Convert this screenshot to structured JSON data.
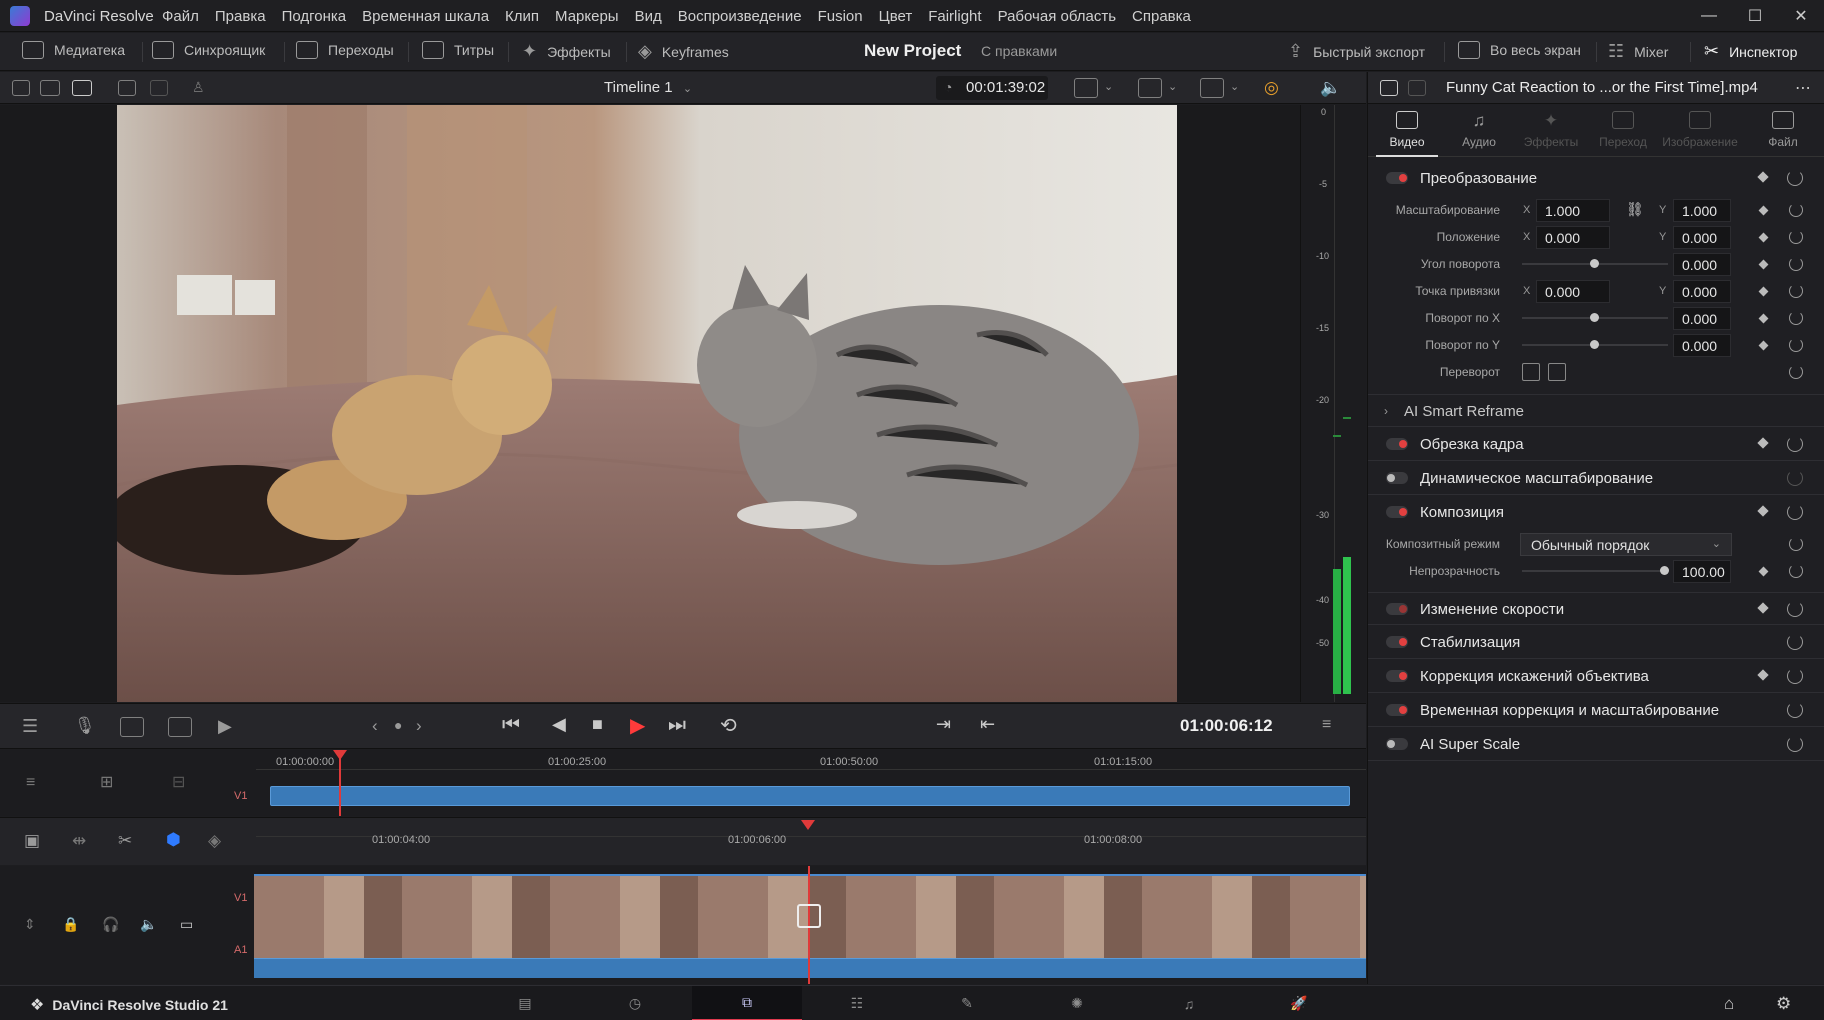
{
  "app": {
    "title": "DaVinci Resolve",
    "menu": [
      "Файл",
      "Правка",
      "Подгонка",
      "Временная шкала",
      "Клип",
      "Маркеры",
      "Вид",
      "Воспроизведение",
      "Fusion",
      "Цвет",
      "Fairlight",
      "Рабочая область",
      "Справка"
    ],
    "window_controls": [
      "—",
      "☐",
      "✕"
    ]
  },
  "toolbar": {
    "media_pool": "Медиатека",
    "sync_bin": "Синхроящик",
    "transitions": "Переходы",
    "titles": "Титры",
    "effects": "Эффекты",
    "keyframes": "Keyframes",
    "project_title": "New Project",
    "project_subtitle": "С правками",
    "quick_export": "Быстрый экспорт",
    "fullscreen": "Во весь экран",
    "mixer": "Mixer",
    "inspector": "Инспектор"
  },
  "viewer": {
    "timeline_name": "Timeline 1",
    "duration_tc": "00:01:39:02",
    "meter_scale": [
      "0",
      "-5",
      "-10",
      "-15",
      "-20",
      "-30",
      "-40",
      "-50"
    ]
  },
  "transport": {
    "timecode": "01:00:06:12"
  },
  "upper_timeline": {
    "ruler": [
      "01:00:00:00",
      "01:00:25:00",
      "01:00:50:00",
      "01:01:15:00"
    ],
    "track": "V1"
  },
  "lower_timeline": {
    "ruler": [
      "01:00:04:00",
      "01:00:06:00",
      "01:00:08:00"
    ],
    "tracks": [
      "V1",
      "A1"
    ]
  },
  "bottombar": {
    "brand": "DaVinci Resolve Studio 21"
  },
  "inspector": {
    "file_name": "Funny Cat Reaction to ...or the First Time].mp4",
    "tabs": [
      "Видео",
      "Аудио",
      "Эффекты",
      "Переход",
      "Изображение",
      "Файл"
    ],
    "transform": {
      "title": "Преобразование",
      "zoom_label": "Масштабирование",
      "zoom_x": "1.000",
      "zoom_y": "1.000",
      "position_label": "Положение",
      "position_x": "0.000",
      "position_y": "0.000",
      "rotation_label": "Угол поворота",
      "rotation": "0.000",
      "anchor_label": "Точка привязки",
      "anchor_x": "0.000",
      "anchor_y": "0.000",
      "pitch_label": "Поворот по X",
      "pitch": "0.000",
      "yaw_label": "Поворот по Y",
      "yaw": "0.000",
      "flip_label": "Переворот",
      "x": "X",
      "y": "Y"
    },
    "smart_reframe": "AI Smart Reframe",
    "cropping": "Обрезка кадра",
    "dynamic_zoom": "Динамическое масштабирование",
    "composite": {
      "title": "Композиция",
      "mode_label": "Композитный режим",
      "mode_value": "Обычный порядок",
      "opacity_label": "Непрозрачность",
      "opacity": "100.00"
    },
    "speed_change": "Изменение скорости",
    "stabilization": "Стабилизация",
    "lens_correction": "Коррекция искажений объектива",
    "retime_scaling": "Временная коррекция и масштабирование",
    "super_scale": "AI Super Scale"
  }
}
